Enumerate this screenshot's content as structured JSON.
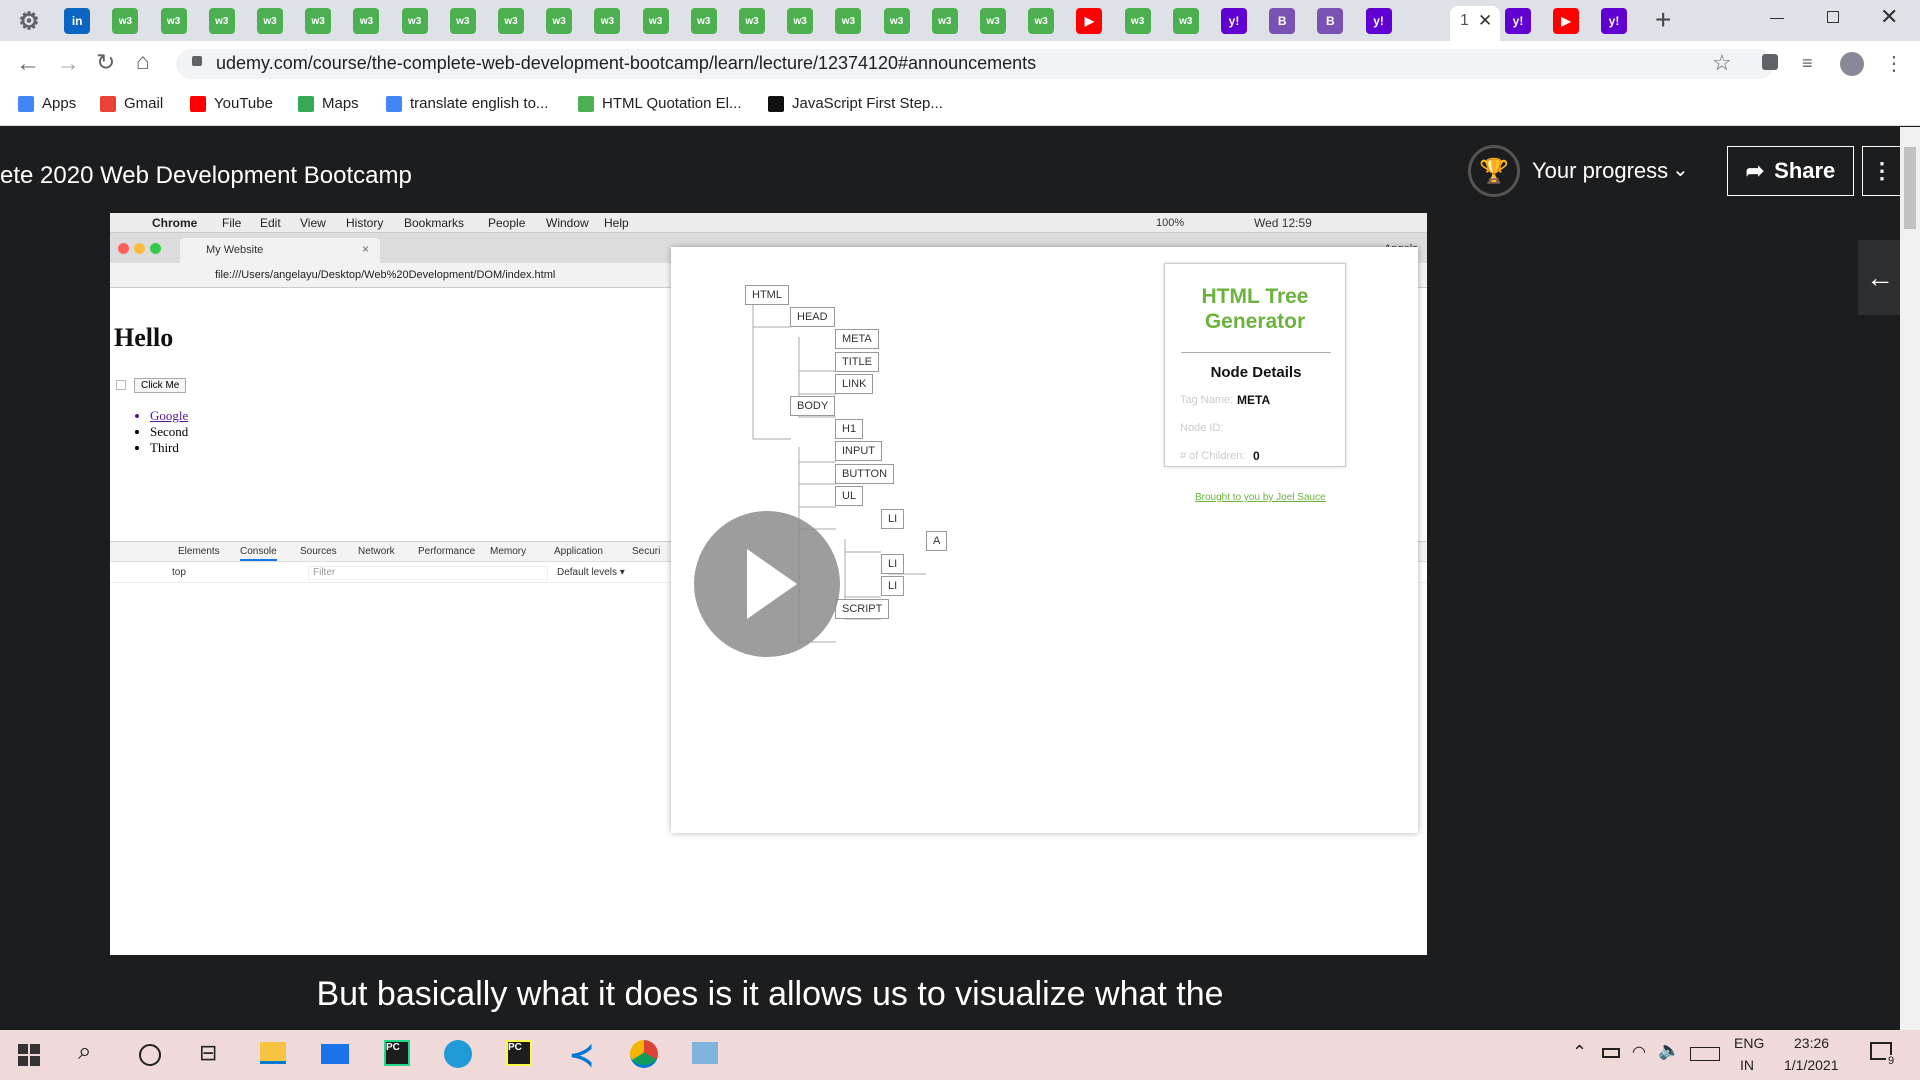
{
  "browser": {
    "active_tab_glyph": "1",
    "close_glyph": "✕",
    "new_tab_glyph": "+",
    "url": "udemy.com/course/the-complete-web-development-bootcamp/learn/lecture/12374120#announcements",
    "tab_icons": [
      "gear-icon",
      "linkedin-icon",
      "w3-icon",
      "w3-icon",
      "w3-icon",
      "w3-icon",
      "w3-icon",
      "w3-icon",
      "w3-icon",
      "w3-icon",
      "w3-icon",
      "w3-icon",
      "w3-icon",
      "w3-icon",
      "w3-icon",
      "w3-icon",
      "w3-icon",
      "w3-icon",
      "w3-icon",
      "w3-icon",
      "w3-icon",
      "w3-icon",
      "youtube-icon",
      "w3-icon",
      "w3-icon",
      "yahoo-icon",
      "bootstrap-icon",
      "bootstrap-icon",
      "yahoo-icon"
    ],
    "after_active_tabs": [
      "yahoo-icon",
      "youtube-icon",
      "yahoo-icon"
    ],
    "bookmarks": [
      {
        "label": "Apps",
        "icon": "apps-icon"
      },
      {
        "label": "Gmail",
        "icon": "gmail-icon"
      },
      {
        "label": "YouTube",
        "icon": "youtube-icon"
      },
      {
        "label": "Maps",
        "icon": "maps-icon"
      },
      {
        "label": "translate english to...",
        "icon": "google-icon"
      },
      {
        "label": "HTML Quotation El...",
        "icon": "w3-icon"
      },
      {
        "label": "JavaScript First Step...",
        "icon": "mdn-icon"
      }
    ]
  },
  "udemy": {
    "course_title": "ete 2020 Web Development Bootcamp",
    "progress_label": "Your progress",
    "share_label": "Share",
    "caption": "But basically what it does is it allows us to visualize what the"
  },
  "video": {
    "menubar": [
      "Chrome",
      "File",
      "Edit",
      "View",
      "History",
      "Bookmarks",
      "People",
      "Window",
      "Help"
    ],
    "battery": "100%",
    "clock": "Wed 12:59",
    "user": "Angela",
    "tab_title": "My Website",
    "file_url": "file:///Users/angelayu/Desktop/Web%20Development/DOM/index.html",
    "page_heading": "Hello",
    "button_label": "Click Me",
    "list": [
      "Google",
      "Second",
      "Third"
    ],
    "devtools_tabs": [
      "Elements",
      "Console",
      "Sources",
      "Network",
      "Performance",
      "Memory",
      "Application",
      "Securi"
    ],
    "console_context": "top",
    "filter_placeholder": "Filter",
    "levels": "Default levels ▾",
    "tree_nodes": [
      "HTML",
      "HEAD",
      "META",
      "TITLE",
      "LINK",
      "BODY",
      "H1",
      "INPUT",
      "BUTTON",
      "UL",
      "LI",
      "A",
      "LI",
      "LI",
      "SCRIPT"
    ],
    "panel_title": "HTML Tree Generator",
    "node_details": "Node Details",
    "tag_name_label": "Tag Name:",
    "tag_name_value": "META",
    "node_id_label": "Node ID:",
    "children_label": "# of Children:",
    "children_value": "0",
    "credit": "Brought to you by Joel Sauce"
  },
  "taskbar": {
    "lang": "ENG",
    "region": "IN",
    "time": "23:26",
    "date": "1/1/2021",
    "notif_count": "9"
  },
  "colors": {
    "accent_green": "#6cb33e",
    "udemy_dark": "#1c1d1f",
    "taskbar": "#f0d9d9"
  }
}
